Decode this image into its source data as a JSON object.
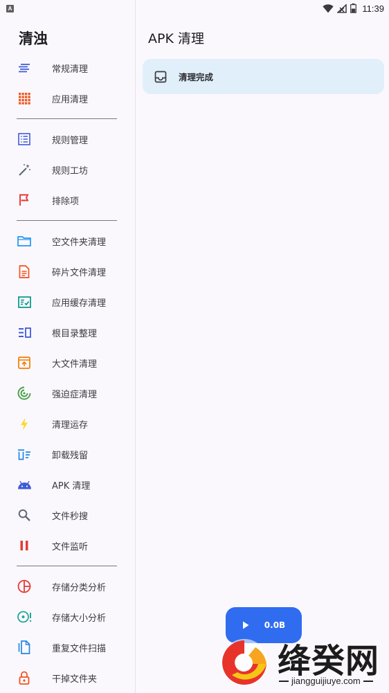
{
  "status_bar": {
    "notification": "A",
    "time": "11:39",
    "battery_level": 0.5
  },
  "drawer": {
    "title": "清浊",
    "groups": [
      [
        {
          "label": "常规清理",
          "icon": "lines-icon",
          "color": "#3f5bd8"
        },
        {
          "label": "应用清理",
          "icon": "grid-icon",
          "color": "#ee5a24"
        }
      ],
      [
        {
          "label": "规则管理",
          "icon": "list-icon",
          "color": "#3f5bd8"
        },
        {
          "label": "规则工坊",
          "icon": "magic-wand-icon",
          "color": "#5f6b7a"
        },
        {
          "label": "排除项",
          "icon": "flag-icon",
          "color": "#e53935"
        }
      ],
      [
        {
          "label": "空文件夹清理",
          "icon": "folder-icon",
          "color": "#2196f3"
        },
        {
          "label": "碎片文件清理",
          "icon": "document-icon",
          "color": "#f4511e"
        },
        {
          "label": "应用缓存清理",
          "icon": "checklist-icon",
          "color": "#009688"
        },
        {
          "label": "根目录整理",
          "icon": "columns-icon",
          "color": "#3f5bd8"
        },
        {
          "label": "大文件清理",
          "icon": "archive-icon",
          "color": "#f57c00"
        },
        {
          "label": "强迫症清理",
          "icon": "target-icon",
          "color": "#43a047"
        },
        {
          "label": "清理运存",
          "icon": "lightning-icon",
          "color": "#fdd835"
        },
        {
          "label": "卸载残留",
          "icon": "uninstall-icon",
          "color": "#1e88e5"
        },
        {
          "label": "APK 清理",
          "icon": "android-icon",
          "color": "#3f5bd8"
        },
        {
          "label": "文件秒搜",
          "icon": "search-icon",
          "color": "#5f6b7a"
        },
        {
          "label": "文件监听",
          "icon": "pause-icon",
          "color": "#e53935"
        }
      ],
      [
        {
          "label": "存储分类分析",
          "icon": "pie-chart-icon",
          "color": "#e53935"
        },
        {
          "label": "存储大小分析",
          "icon": "storage-alert-icon",
          "color": "#26a69a"
        },
        {
          "label": "重复文件扫描",
          "icon": "copy-icon",
          "color": "#1e88e5"
        },
        {
          "label": "干掉文件夹",
          "icon": "lock-icon",
          "color": "#f4511e"
        }
      ]
    ]
  },
  "main": {
    "title": "APK 清理",
    "result_card": {
      "text": "清理完成"
    },
    "fab": {
      "size": "0.0B"
    }
  },
  "watermark": {
    "text": "绛癸网",
    "url": "jiangguijiuye.com"
  },
  "colors": {
    "background": "#fbf8fd",
    "card": "#e1effb",
    "fab": "#2f6cf0"
  }
}
